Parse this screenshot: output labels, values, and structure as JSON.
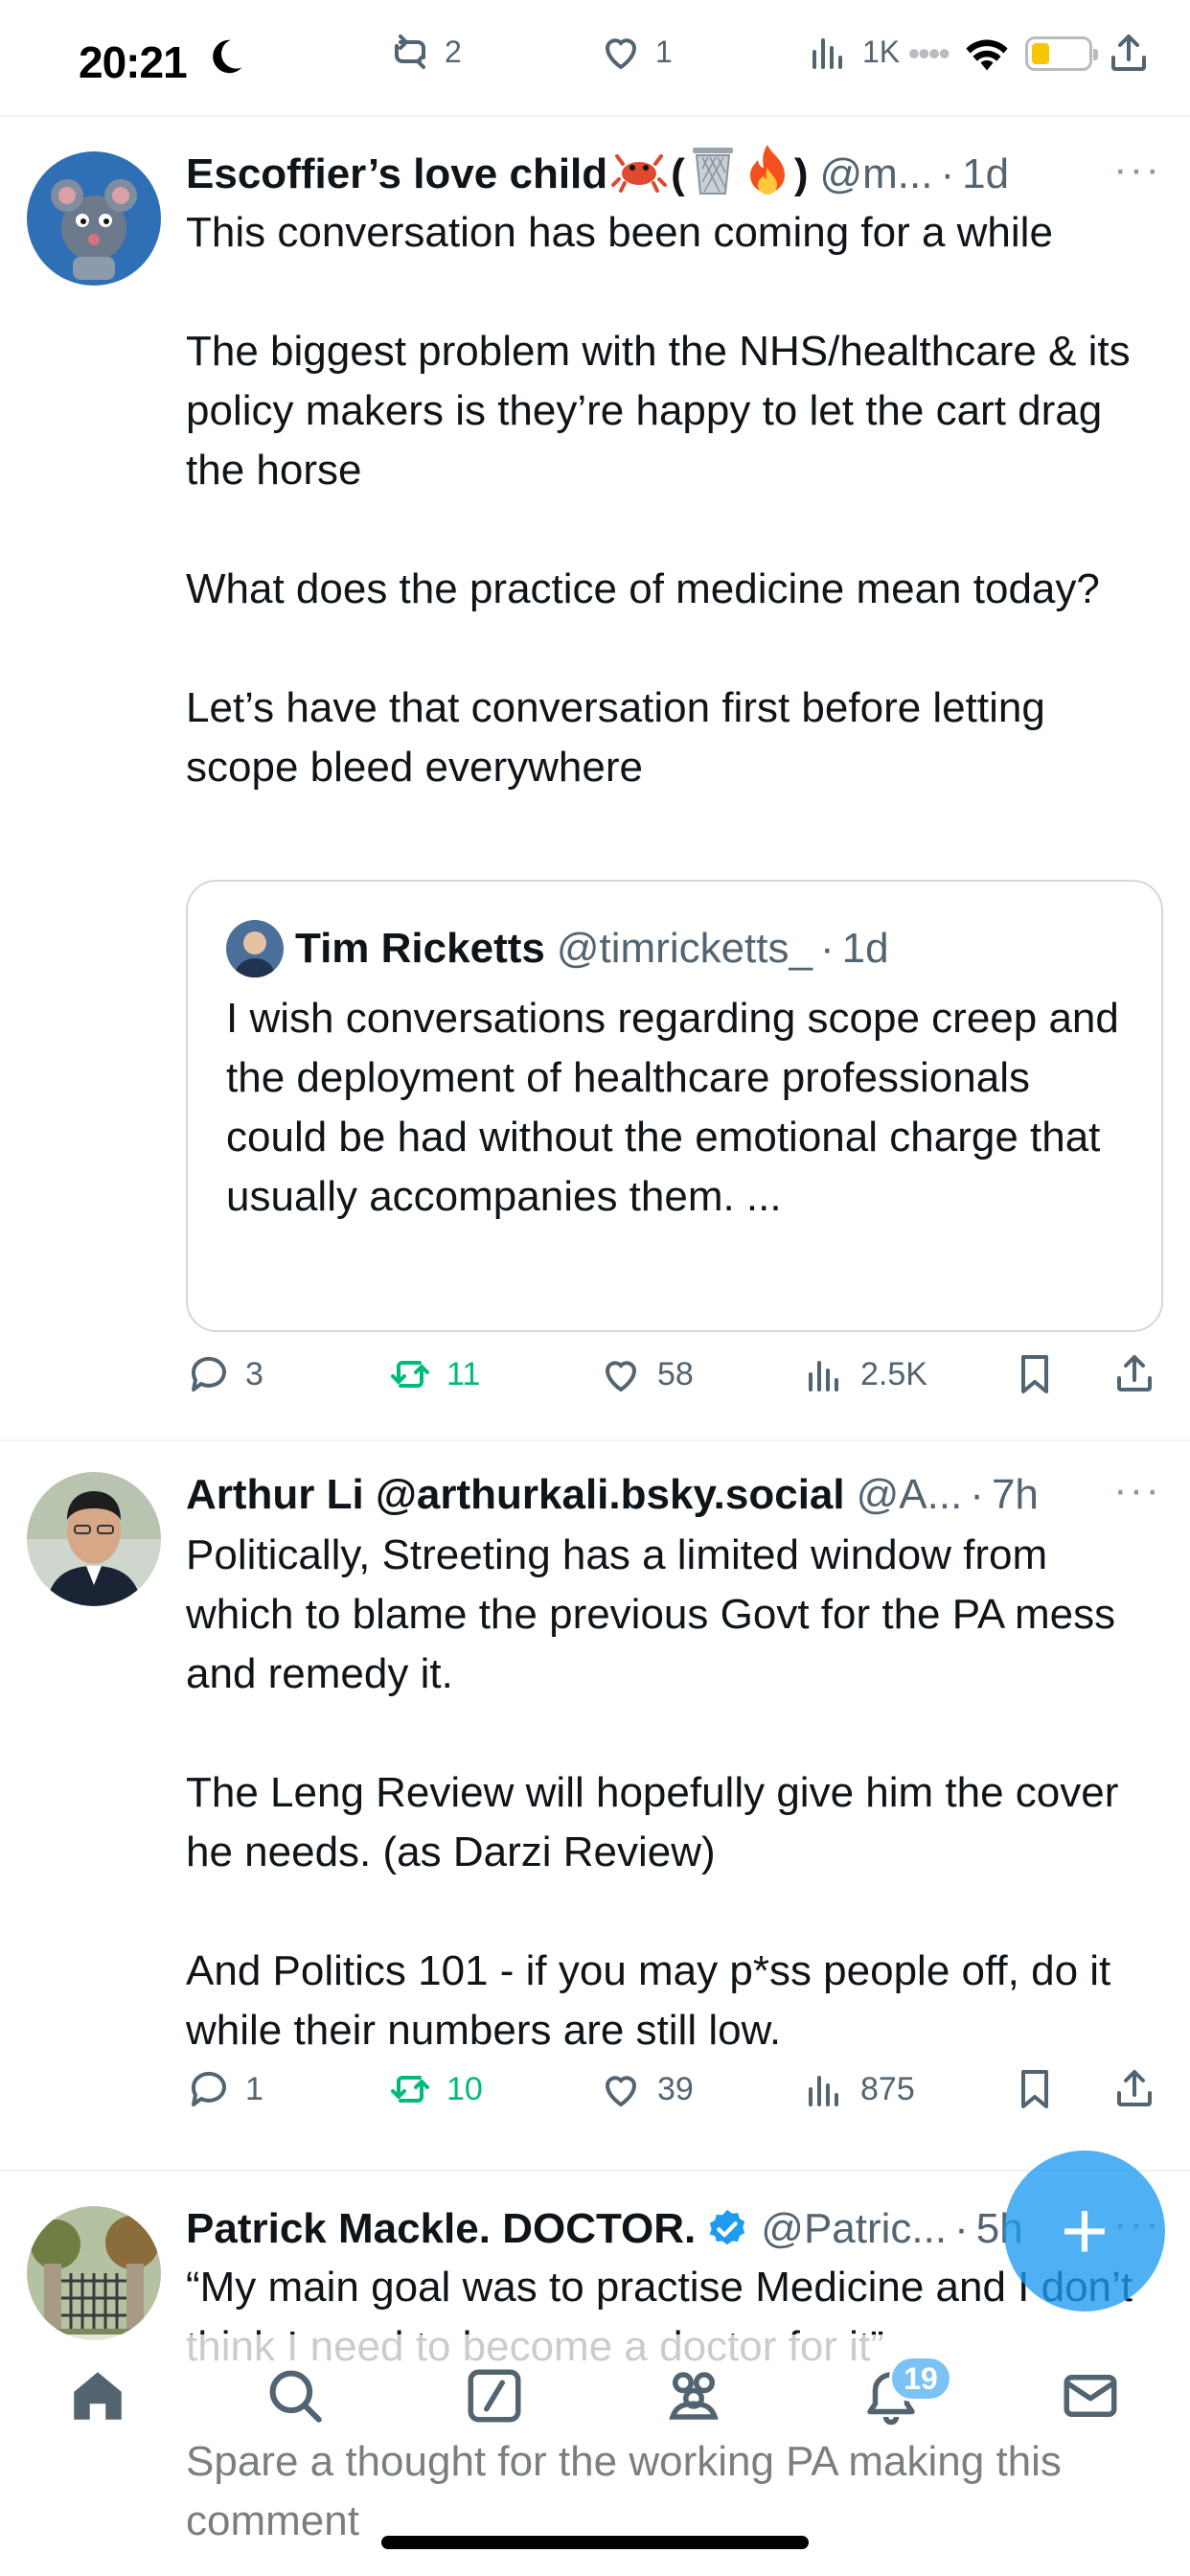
{
  "status_bar": {
    "time": "20:21",
    "strip_retweets": "2",
    "strip_likes": "1",
    "strip_views": "1K"
  },
  "tweets": [
    {
      "name": "Escoffier’s love child",
      "name_suffix_open": "(",
      "name_suffix_close": ")",
      "handle": "@m...",
      "dot": "·",
      "age": "1d",
      "more": "···",
      "body": [
        "This conversation has been coming for a while",
        "The biggest problem with the NHS/healthcare & its policy makers is they’re happy to let the cart drag the horse",
        "What does the practice of medicine mean today?",
        "Let’s have that conversation first before letting scope bleed everywhere"
      ],
      "quote": {
        "name": "Tim Ricketts",
        "handle": "@timricketts_",
        "dot": "·",
        "age": "1d",
        "body": "I wish conversations regarding scope creep and the deployment of healthcare professionals could be had without the emotional charge that usually accompanies them. ..."
      },
      "replies": "3",
      "retweets": "11",
      "likes": "58",
      "views": "2.5K"
    },
    {
      "name": "Arthur Li @arthurkali.bsky.social",
      "handle": "@A...",
      "dot": "·",
      "age": "7h",
      "more": "···",
      "body": [
        "Politically, Streeting has a limited window from which to blame the previous Govt for the PA mess and remedy it.",
        "The Leng Review will hopefully give him the cover he needs. (as Darzi Review)",
        "And Politics 101 - if you may p*ss people off, do it while their numbers are still low."
      ],
      "replies": "1",
      "retweets": "10",
      "likes": "39",
      "views": "875"
    },
    {
      "name": "Patrick Mackle. DOCTOR.",
      "handle": "@Patric...",
      "dot": "·",
      "age": "5h",
      "more": "···",
      "body": [
        "“My main goal was to practise Medicine and I don’t think I need to become a doctor for it”",
        "Spare a thought for the working PA making this comment"
      ]
    }
  ],
  "fab": {
    "label": "+"
  },
  "tab_bar": {
    "notifications_badge": "19",
    "tabs": [
      "home-icon",
      "search-icon",
      "grok-icon",
      "communities-icon",
      "notifications-icon",
      "messages-icon"
    ]
  },
  "colors": {
    "accent": "#1d9bf0",
    "retweet_green": "#00ba7c",
    "secondary_text": "#536471",
    "border": "#eff3f4"
  }
}
